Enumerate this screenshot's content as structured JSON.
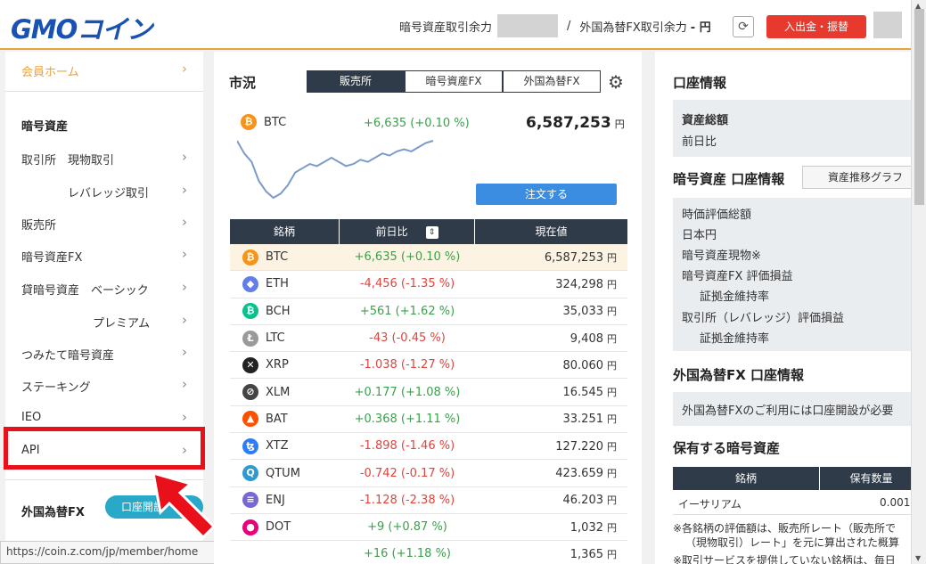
{
  "header": {
    "logo": "GMOコイン",
    "crypto_balance_label": "暗号資産取引余力",
    "separator": "/",
    "fx_balance_label": "外国為替FX取引余力",
    "fx_balance_value": "- 円",
    "deposit_button": "入出金・振替"
  },
  "sidebar": {
    "home": "会員ホーム",
    "crypto_heading": "暗号資産",
    "items": [
      {
        "label": "取引所　現物取引"
      },
      {
        "label": "レバレッジ取引"
      },
      {
        "label": "販売所"
      },
      {
        "label": "暗号資産FX"
      },
      {
        "label": "貸暗号資産　ベーシック"
      },
      {
        "label": "プレミアム"
      },
      {
        "label": "つみたて暗号資産"
      },
      {
        "label": "ステーキング"
      },
      {
        "label": "IEO"
      },
      {
        "label": "API"
      }
    ],
    "fx_heading": "外国為替FX",
    "account_open_button": "口座開設"
  },
  "statusbar": {
    "url": "https://coin.z.com/jp/member/home"
  },
  "market": {
    "title": "市況",
    "tabs": [
      "販売所",
      "暗号資産FX",
      "外国為替FX"
    ],
    "active_tab": 0,
    "featured": {
      "symbol": "BTC",
      "change": "+6,635 (+0.10 %)",
      "price": "6,587,253",
      "unit": "円"
    },
    "sparkline": [
      60,
      48,
      40,
      22,
      12,
      6,
      10,
      18,
      30,
      34,
      38,
      36,
      40,
      44,
      40,
      36,
      38,
      42,
      40,
      44,
      48,
      46,
      50,
      52,
      50,
      54,
      58,
      60
    ],
    "order_button": "注文する",
    "columns": [
      "銘柄",
      "前日比",
      "現在値"
    ],
    "rows": [
      {
        "symbol": "BTC",
        "change": "+6,635 (+0.10 %)",
        "price": "6,587,253",
        "dir": "pos",
        "icon": "bitcoin-icon",
        "color": "#f7931a",
        "glyph": "₿"
      },
      {
        "symbol": "ETH",
        "change": "-4,456 (-1.35 %)",
        "price": "324,298",
        "dir": "neg",
        "icon": "ethereum-icon",
        "color": "#627eea",
        "glyph": "◆"
      },
      {
        "symbol": "BCH",
        "change": "+561 (+1.62 %)",
        "price": "35,033",
        "dir": "pos",
        "icon": "bitcoin-cash-icon",
        "color": "#0ac18e",
        "glyph": "₿"
      },
      {
        "symbol": "LTC",
        "change": "-43 (-0.45 %)",
        "price": "9,408",
        "dir": "neg",
        "icon": "litecoin-icon",
        "color": "#9a9a9a",
        "glyph": "Ł"
      },
      {
        "symbol": "XRP",
        "change": "-1.038 (-1.27 %)",
        "price": "80.060",
        "dir": "neg",
        "icon": "xrp-icon",
        "color": "#222222",
        "glyph": "✕"
      },
      {
        "symbol": "XLM",
        "change": "+0.177 (+1.08 %)",
        "price": "16.545",
        "dir": "pos",
        "icon": "stellar-icon",
        "color": "#444444",
        "glyph": "⊘"
      },
      {
        "symbol": "BAT",
        "change": "+0.368 (+1.11 %)",
        "price": "33.251",
        "dir": "pos",
        "icon": "bat-icon",
        "color": "#ff5000",
        "glyph": "▲"
      },
      {
        "symbol": "XTZ",
        "change": "-1.898 (-1.46 %)",
        "price": "127.220",
        "dir": "neg",
        "icon": "tezos-icon",
        "color": "#2c7df7",
        "glyph": "ꜩ"
      },
      {
        "symbol": "QTUM",
        "change": "-0.742 (-0.17 %)",
        "price": "423.659",
        "dir": "neg",
        "icon": "qtum-icon",
        "color": "#2e9ad0",
        "glyph": "Q"
      },
      {
        "symbol": "ENJ",
        "change": "-1.128 (-2.38 %)",
        "price": "46.203",
        "dir": "neg",
        "icon": "enjin-icon",
        "color": "#7866d5",
        "glyph": "≡"
      },
      {
        "symbol": "DOT",
        "change": "+9 (+0.87 %)",
        "price": "1,032",
        "dir": "pos",
        "icon": "polkadot-icon",
        "color": "#e6007a",
        "glyph": "●"
      },
      {
        "symbol": "",
        "change": "+16 (+1.18 %)",
        "price": "1,365",
        "dir": "pos",
        "icon": "",
        "color": "",
        "glyph": ""
      }
    ],
    "unit": "円"
  },
  "account": {
    "title": "口座情報",
    "total_assets_label": "資産総額",
    "prev_day_label": "前日比",
    "crypto_title": "暗号資産 口座情報",
    "graph_button": "資産推移グラフ",
    "crypto_lines": [
      "時価評価総額",
      "日本円",
      "暗号資産現物※",
      "暗号資産FX 評価損益",
      "証拠金維持率",
      "取引所（レバレッジ）評価損益",
      "証拠金維持率"
    ],
    "fx_title": "外国為替FX 口座情報",
    "fx_notice": "外国為替FXのご利用には口座開設が必要",
    "holdings_title": "保有する暗号資産",
    "holdings_columns": [
      "銘柄",
      "保有数量"
    ],
    "holdings_rows": [
      {
        "name": "イーサリアム",
        "qty": "0.001"
      }
    ],
    "note1": "※各銘柄の評価額は、販売所レート（販売所で",
    "note2": "（現物取引）レート」を元に算出された概算",
    "note3": "※取引サービスを提供していない銘柄は、毎日"
  }
}
